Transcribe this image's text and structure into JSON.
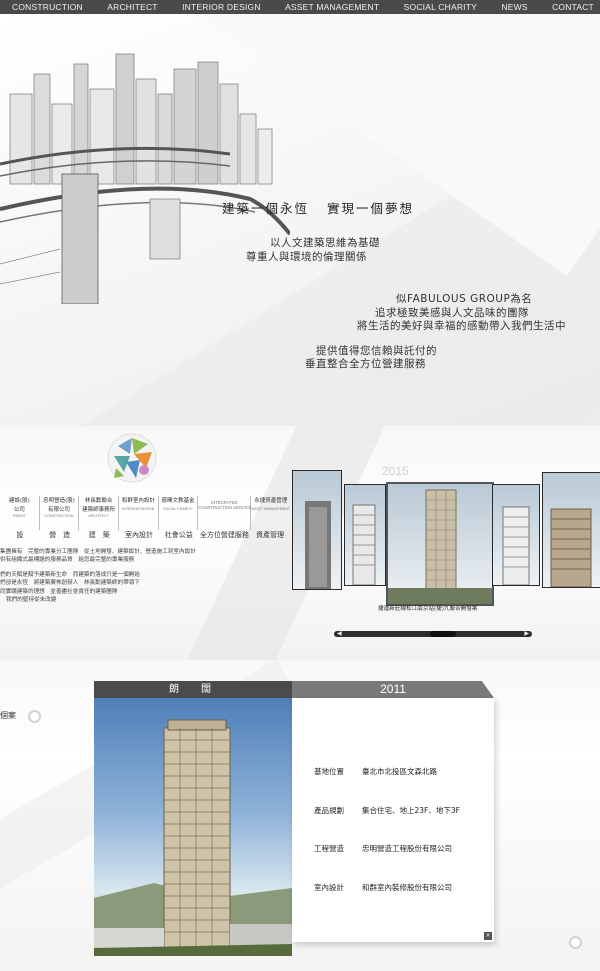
{
  "nav": {
    "items": [
      "CONSTRUCTION",
      "ARCHITECT",
      "INTERIOR DESIGN",
      "ASSET MANAGEMENT",
      "SOCIAL CHARITY",
      "NEWS",
      "CONTACT"
    ]
  },
  "hero": {
    "title_1": "建築一個永恆",
    "title_2": "實現一個夢想",
    "line_1": "以人文建築思維為基礎",
    "line_2": "尊重人與環境的倫理關係",
    "line_3": "似FABULOUS GROUP為名",
    "line_4": "追求極致美感與人文品味的團隊",
    "line_5": "將生活的美好與幸福的感動帶入我們生活中",
    "line_6": "提供值得您信賴與託付的",
    "line_7": "垂直整合全方位營建服務"
  },
  "group": {
    "categories": [
      {
        "cn1": "建設(股)",
        "cn2": "公司",
        "en": "PMENT"
      },
      {
        "cn1": "忠明營造(股)",
        "cn2": "有限公司",
        "en": "CONSTRUCTION"
      },
      {
        "cn1": "林長勳聯合",
        "cn2": "建築師事務所",
        "en": "ARCHITECT"
      },
      {
        "cn1": "和群室內設計",
        "cn2": "",
        "en": "INTERIOR DESIGN"
      },
      {
        "cn1": "慈暉文教基金",
        "cn2": "",
        "en": "SOCIAL CHARITY"
      },
      {
        "cn1": "INTEGRATED",
        "cn2": "CONSTRUCTION SERVICE",
        "en": ""
      },
      {
        "cn1": "永捷資產管理",
        "cn2": "",
        "en": "ASSET MANAGEMENT"
      }
    ],
    "labels": [
      "設",
      "營　造",
      "建　築",
      "室內設計",
      "社會公益",
      "全方位營建服務",
      "資產管理"
    ],
    "para_1": "集團擁有　完整的專業分工團隊　從土地開發、建築設計、營造施工到室內設計",
    "para_2": "供有組織式最標題的服務品質　給您最完整的專業服務",
    "para_3": "",
    "para_4": "們的天賦是賦予建築新生命　而建築的落成只是一個開始",
    "para_5": "們卻是永恆　將建築廣佈創辦人　林長勳建築師的帶領下",
    "para_6": "同實踐建築的理想　並善盡社會責任的建築團隊",
    "para_7": "我們的堅持從未改變"
  },
  "gallery": {
    "year": "2015",
    "caption": "捷運新莊線松江南京站(捷)九聯合開發案",
    "prev_arrow": "◀",
    "next_arrow": "▶"
  },
  "project": {
    "side_label": "個案",
    "name": "朗　闊",
    "year": "2011",
    "details": [
      {
        "key": "基地位置",
        "value": "臺北市北投區文森北路"
      },
      {
        "key": "產品規劃",
        "value": "集合住宅、地上23F、地下3F"
      },
      {
        "key": "工程營造",
        "value": "忠明營造工程股份有限公司"
      },
      {
        "key": "室內設計",
        "value": "和群室內裝修股份有限公司"
      }
    ],
    "close": "×"
  }
}
